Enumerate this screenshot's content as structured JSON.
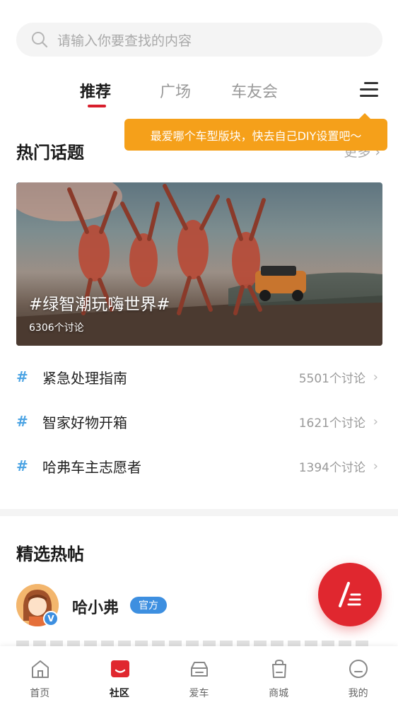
{
  "search": {
    "placeholder": "请输入你要查找的内容",
    "icon": "search-icon"
  },
  "tabs": [
    {
      "label": "推荐",
      "active": true
    },
    {
      "label": "广场",
      "active": false
    },
    {
      "label": "车友会",
      "active": false
    }
  ],
  "tooltip": {
    "text": "最爱哪个车型版块，快去自己DIY设置吧～"
  },
  "hot_topics": {
    "title": "热门话题",
    "more_label": "更多",
    "banner": {
      "tag": "#绿智潮玩嗨世界#",
      "count": "6306个讨论"
    },
    "items": [
      {
        "hash": "#",
        "name": "紧急处理指南",
        "count": "5501个讨论"
      },
      {
        "hash": "#",
        "name": "智家好物开箱",
        "count": "1621个讨论"
      },
      {
        "hash": "#",
        "name": "哈弗车主志愿者",
        "count": "1394个讨论"
      }
    ]
  },
  "featured": {
    "title": "精选热帖",
    "user": {
      "name": "哈小弗",
      "badge": "官方",
      "verified_mark": "V"
    }
  },
  "bottom_nav": [
    {
      "label": "首页",
      "icon": "home-icon",
      "active": false
    },
    {
      "label": "社区",
      "icon": "community-icon",
      "active": true
    },
    {
      "label": "爱车",
      "icon": "car-icon",
      "active": false
    },
    {
      "label": "商城",
      "icon": "shop-bag-icon",
      "active": false
    },
    {
      "label": "我的",
      "icon": "profile-icon",
      "active": false
    }
  ],
  "colors": {
    "accent": "#d81e2c",
    "tooltip": "#f5a01a",
    "hash": "#4ba3e3",
    "official": "#3d8fe0"
  }
}
